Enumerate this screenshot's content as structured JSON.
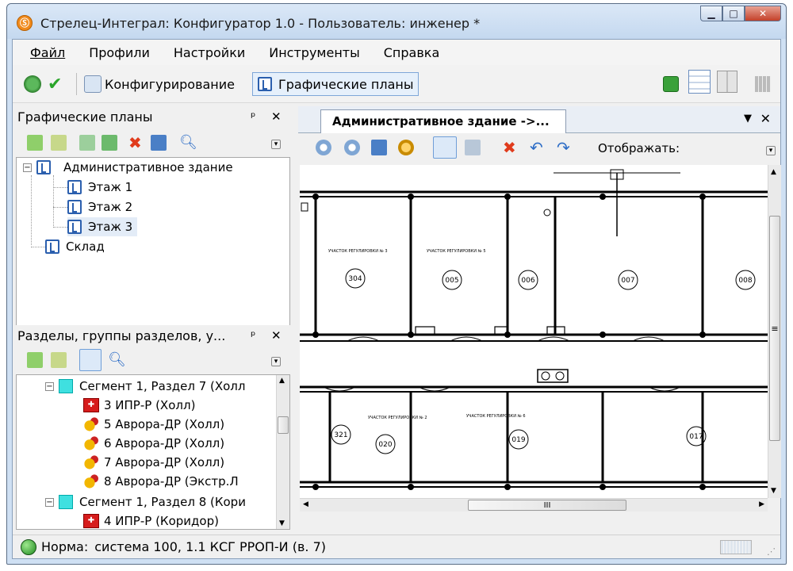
{
  "window": {
    "title": "Стрелец-Интеграл: Конфигуратор 1.0 - Пользователь: инженер *",
    "app_icon_glyph": "Ⓢ"
  },
  "menu": [
    "Файл",
    "Профили",
    "Настройки",
    "Инструменты",
    "Справка"
  ],
  "toolbar": {
    "configure_label": "Конфигурирование",
    "plans_label": "Графические планы"
  },
  "plans_pane": {
    "title": "Графические планы",
    "tree": {
      "building": "Административное здание",
      "floors": [
        "Этаж 1",
        "Этаж 2",
        "Этаж 3"
      ],
      "warehouse": "Склад"
    }
  },
  "sections_pane": {
    "title": "Разделы, группы разделов, у...",
    "items": [
      {
        "kind": "segment",
        "label": "Сегмент 1, Раздел 7 (Холл"
      },
      {
        "kind": "ipr",
        "label": "3 ИПР-Р (Холл)"
      },
      {
        "kind": "avrora",
        "label": "5 Аврора-ДР (Холл)"
      },
      {
        "kind": "avrora",
        "label": "6 Аврора-ДР (Холл)"
      },
      {
        "kind": "avrora",
        "label": "7 Аврора-ДР (Холл)"
      },
      {
        "kind": "avrora",
        "label": "8 Аврора-ДР (Экстр.Л"
      },
      {
        "kind": "segment",
        "label": "Сегмент 1, Раздел 8 (Кори"
      },
      {
        "kind": "ipr",
        "label": "4 ИПР-Р (Коридор)"
      }
    ]
  },
  "document": {
    "tab_title": "Административное здание ->...",
    "display_label": "Отображать:"
  },
  "plan_rooms": [
    "304",
    "005",
    "006",
    "007",
    "008",
    "321",
    "020",
    "019",
    "017"
  ],
  "plan_captions": [
    "УЧАСТОК РЕГУЛИРОВКИ № 3",
    "УЧАСТОК РЕГУЛИРОВКИ № 5",
    "УЧАСТОК РЕГУЛИРОВКИ № 2",
    "УЧАСТОК РЕГУЛИРОВКИ № 6"
  ],
  "status": {
    "state": "Норма:",
    "info": "система 100, 1.1 КСГ РРОП-И (в. 7)"
  },
  "scroll": {
    "h_thumb_glyph": "III",
    "v_thumb_glyph": "≡"
  },
  "colors": {
    "accent": "#2b5fae",
    "ok": "#1f8a1f",
    "alarm": "#d61c1c"
  }
}
